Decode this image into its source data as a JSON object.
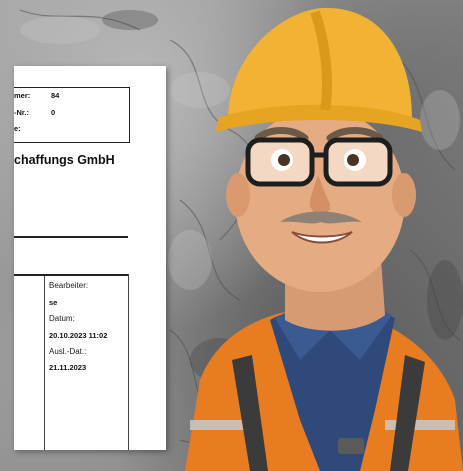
{
  "document": {
    "rows": [
      {
        "label": "mer:",
        "value": "84"
      },
      {
        "label": "-Nr.:",
        "value": "0"
      },
      {
        "label": "e:",
        "value": ""
      }
    ],
    "company": "chaffungs GmbH",
    "fields": {
      "bearbeiter_label": "Bearbeiter:",
      "bearbeiter_value": "se",
      "datum_label": "Datum:",
      "datum_value": "20.10.2023 11:02",
      "ausl_label": "Ausl.-Dat.:",
      "ausl_value": "21.11.2023"
    }
  },
  "illustration": {
    "subject": "construction-worker",
    "helmet_color": "#f2b233",
    "vest_color": "#e77c20",
    "shirt_color": "#2f4a7a"
  }
}
